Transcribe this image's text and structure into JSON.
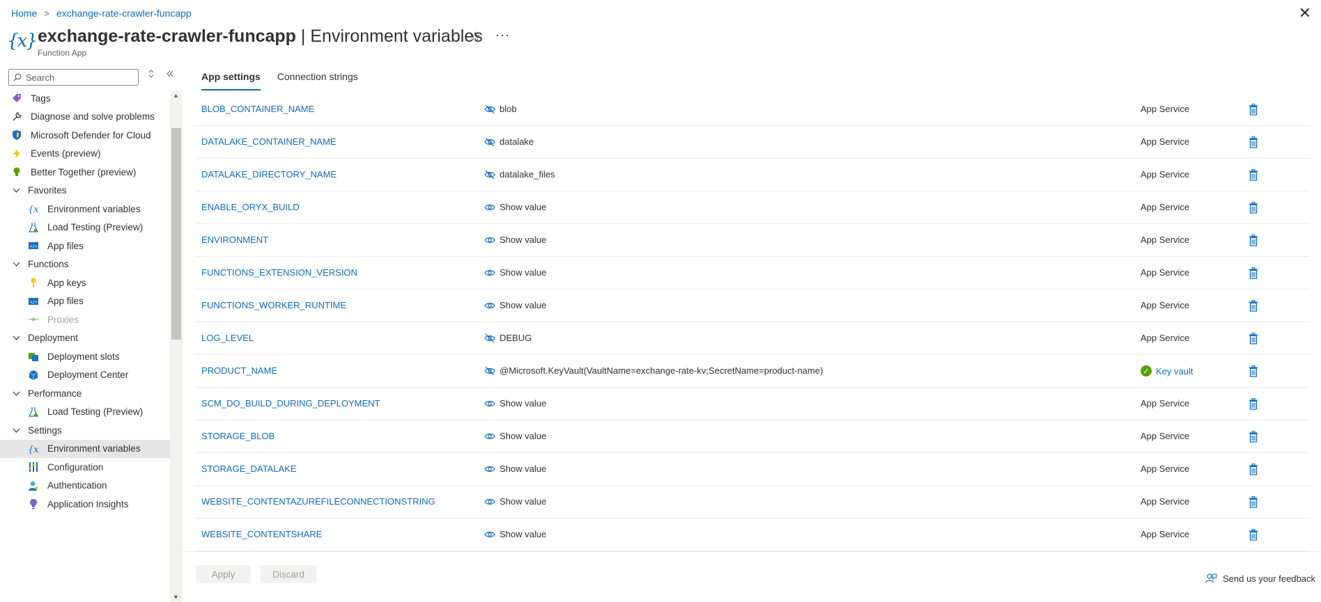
{
  "breadcrumb": {
    "home": "Home",
    "resource": "exchange-rate-crawler-funcapp",
    "separator": ">"
  },
  "header": {
    "resource_name": "exchange-rate-crawler-funcapp",
    "separator": "|",
    "page_name": "Environment variables",
    "subtitle": "Function App",
    "title_icon_glyph": "{x}",
    "star_glyph": "☆",
    "more_glyph": "···",
    "close_glyph": "✕"
  },
  "sidebar": {
    "search_placeholder": "Search",
    "items": [
      {
        "kind": "top",
        "label": "Tags",
        "icon": "tag-icon"
      },
      {
        "kind": "top",
        "label": "Diagnose and solve problems",
        "icon": "wrench-icon"
      },
      {
        "kind": "top",
        "label": "Microsoft Defender for Cloud",
        "icon": "shield-icon"
      },
      {
        "kind": "top",
        "label": "Events (preview)",
        "icon": "lightning-icon"
      },
      {
        "kind": "top",
        "label": "Better Together (preview)",
        "icon": "lightbulb-icon"
      },
      {
        "kind": "group",
        "label": "Favorites"
      },
      {
        "kind": "sub",
        "label": "Environment variables",
        "icon": "variable-icon"
      },
      {
        "kind": "sub",
        "label": "Load Testing (Preview)",
        "icon": "flask-icon"
      },
      {
        "kind": "sub",
        "label": "App files",
        "icon": "code-file-icon"
      },
      {
        "kind": "group",
        "label": "Functions"
      },
      {
        "kind": "sub",
        "label": "App keys",
        "icon": "key-icon"
      },
      {
        "kind": "sub",
        "label": "App files",
        "icon": "code-file-icon"
      },
      {
        "kind": "sub",
        "label": "Proxies",
        "icon": "proxy-icon",
        "disabled": true
      },
      {
        "kind": "group",
        "label": "Deployment"
      },
      {
        "kind": "sub",
        "label": "Deployment slots",
        "icon": "slots-icon"
      },
      {
        "kind": "sub",
        "label": "Deployment Center",
        "icon": "cube-icon"
      },
      {
        "kind": "group",
        "label": "Performance"
      },
      {
        "kind": "sub",
        "label": "Load Testing (Preview)",
        "icon": "flask-icon"
      },
      {
        "kind": "group",
        "label": "Settings"
      },
      {
        "kind": "sub",
        "label": "Environment variables",
        "icon": "variable-icon",
        "selected": true
      },
      {
        "kind": "sub",
        "label": "Configuration",
        "icon": "sliders-icon"
      },
      {
        "kind": "sub",
        "label": "Authentication",
        "icon": "person-icon"
      },
      {
        "kind": "sub",
        "label": "Application Insights",
        "icon": "insights-icon"
      }
    ]
  },
  "tabs": [
    {
      "label": "App settings",
      "active": true
    },
    {
      "label": "Connection strings",
      "active": false
    }
  ],
  "settings": [
    {
      "name": "BLOB_CONTAINER_NAME",
      "value": "blob",
      "hidden": false,
      "source": "App Service",
      "keyvault": false
    },
    {
      "name": "DATALAKE_CONTAINER_NAME",
      "value": "datalake",
      "hidden": false,
      "source": "App Service",
      "keyvault": false
    },
    {
      "name": "DATALAKE_DIRECTORY_NAME",
      "value": "datalake_files",
      "hidden": false,
      "source": "App Service",
      "keyvault": false
    },
    {
      "name": "ENABLE_ORYX_BUILD",
      "value": "Show value",
      "hidden": true,
      "source": "App Service",
      "keyvault": false
    },
    {
      "name": "ENVIRONMENT",
      "value": "Show value",
      "hidden": true,
      "source": "App Service",
      "keyvault": false
    },
    {
      "name": "FUNCTIONS_EXTENSION_VERSION",
      "value": "Show value",
      "hidden": true,
      "source": "App Service",
      "keyvault": false
    },
    {
      "name": "FUNCTIONS_WORKER_RUNTIME",
      "value": "Show value",
      "hidden": true,
      "source": "App Service",
      "keyvault": false
    },
    {
      "name": "LOG_LEVEL",
      "value": "DEBUG",
      "hidden": false,
      "source": "App Service",
      "keyvault": false
    },
    {
      "name": "PRODUCT_NAME",
      "value": "@Microsoft.KeyVault(VaultName=exchange-rate-kv;SecretName=product-name)",
      "hidden": false,
      "source": "Key vault",
      "keyvault": true
    },
    {
      "name": "SCM_DO_BUILD_DURING_DEPLOYMENT",
      "value": "Show value",
      "hidden": true,
      "source": "App Service",
      "keyvault": false
    },
    {
      "name": "STORAGE_BLOB",
      "value": "Show value",
      "hidden": true,
      "source": "App Service",
      "keyvault": false
    },
    {
      "name": "STORAGE_DATALAKE",
      "value": "Show value",
      "hidden": true,
      "source": "App Service",
      "keyvault": false
    },
    {
      "name": "WEBSITE_CONTENTAZUREFILECONNECTIONSTRING",
      "value": "Show value",
      "hidden": true,
      "source": "App Service",
      "keyvault": false
    },
    {
      "name": "WEBSITE_CONTENTSHARE",
      "value": "Show value",
      "hidden": true,
      "source": "App Service",
      "keyvault": false
    }
  ],
  "footer": {
    "apply_label": "Apply",
    "discard_label": "Discard",
    "feedback_label": "Send us your feedback"
  },
  "colors": {
    "link": "#0f6cbd",
    "keyvault_check": "#57a300"
  }
}
